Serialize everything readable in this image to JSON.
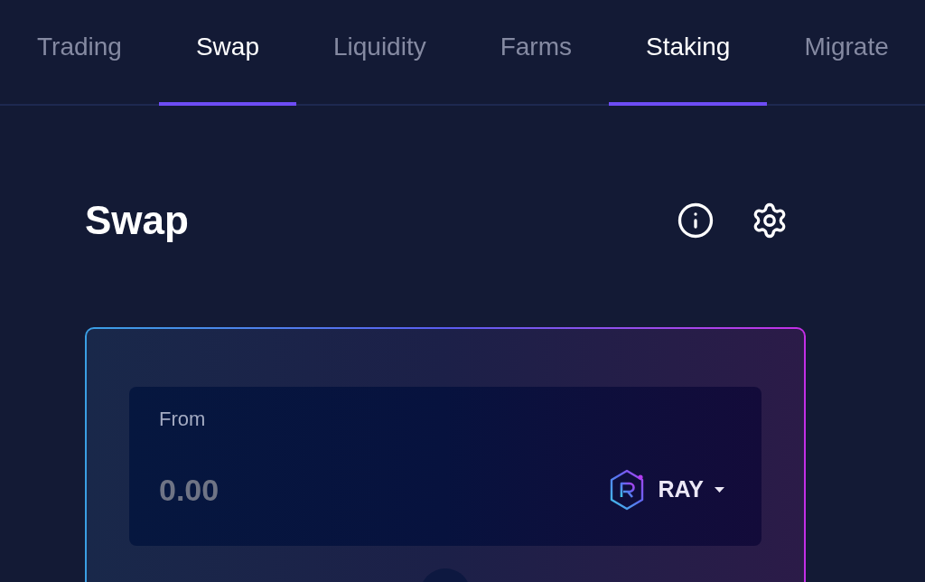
{
  "tabs": [
    {
      "label": "Trading",
      "selected": false
    },
    {
      "label": "Swap",
      "selected": true
    },
    {
      "label": "Liquidity",
      "selected": false
    },
    {
      "label": "Farms",
      "selected": false
    },
    {
      "label": "Staking",
      "selected": true
    },
    {
      "label": "Migrate",
      "selected": false
    }
  ],
  "page": {
    "title": "Swap"
  },
  "swap_card": {
    "from": {
      "label": "From",
      "amount": {
        "placeholder": "0.00"
      },
      "token": {
        "symbol": "RAY"
      }
    }
  }
}
